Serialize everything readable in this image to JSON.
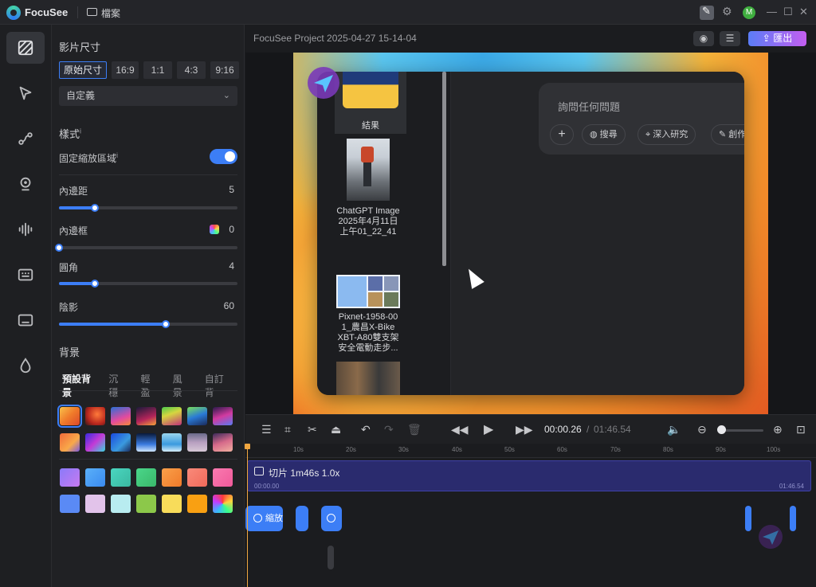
{
  "titlebar": {
    "app_name": "FocuSee",
    "file_menu": "檔案"
  },
  "rail": {
    "items": [
      "background-icon",
      "cursor-icon",
      "path-icon",
      "webcam-icon",
      "audio-icon",
      "caption-icon",
      "subtitle-icon",
      "watermark-icon"
    ]
  },
  "panel": {
    "video_size": {
      "title": "影片尺寸",
      "ratios": [
        "原始尺寸",
        "16:9",
        "1:1",
        "4:3",
        "9:16"
      ],
      "selected_ratio": "原始尺寸",
      "preset_select": "自定義"
    },
    "style": {
      "title": "樣式",
      "info": "i",
      "fixed_zoom": {
        "label": "固定縮放區域",
        "info": "i",
        "enabled": true
      },
      "padding": {
        "label": "內邊距",
        "value": "5",
        "fraction": 0.2
      },
      "border": {
        "label": "內邊框",
        "value": "0",
        "fraction": 0.0
      },
      "radius": {
        "label": "圓角",
        "value": "4",
        "fraction": 0.2
      },
      "shadow": {
        "label": "陰影",
        "value": "60",
        "fraction": 0.6
      }
    },
    "background": {
      "title": "背景",
      "tabs": [
        "預設背景",
        "沉穩",
        "輕盈",
        "風景",
        "自訂背"
      ],
      "active_tab": "預設背景"
    }
  },
  "main": {
    "project_title": "FocuSee Project 2025-04-27 15-14-04",
    "export_label": "匯出",
    "preview": {
      "sidebar_items": [
        {
          "label": "結果"
        },
        {
          "label_lines": [
            "ChatGPT Image",
            "2025年4月11日",
            "上午01_22_41"
          ]
        },
        {
          "label_lines": [
            "Pixnet-1958-00",
            "1_農昌X-Bike",
            "XBT-A80雙支架",
            "安全電動走步..."
          ]
        }
      ],
      "ask_placeholder": "詢問任何問題",
      "chips": [
        "+",
        "搜尋",
        "深入研究",
        "創作"
      ]
    },
    "playback": {
      "time_current": "00:00.26",
      "time_separator": "/",
      "time_total": "01:46.54"
    },
    "timeline": {
      "ticks": [
        "10s",
        "20s",
        "30s",
        "40s",
        "50s",
        "60s",
        "70s",
        "80s",
        "90s",
        "100s"
      ],
      "clip_title": "切片  1m46s  1.0x",
      "clip_start": "00:00.00",
      "clip_end": "01:46.54",
      "zoom_label": "縮放"
    }
  },
  "colors": {
    "accent": "#3c7ef6",
    "playhead": "#f0a640",
    "clip": "#2a2b6e"
  }
}
